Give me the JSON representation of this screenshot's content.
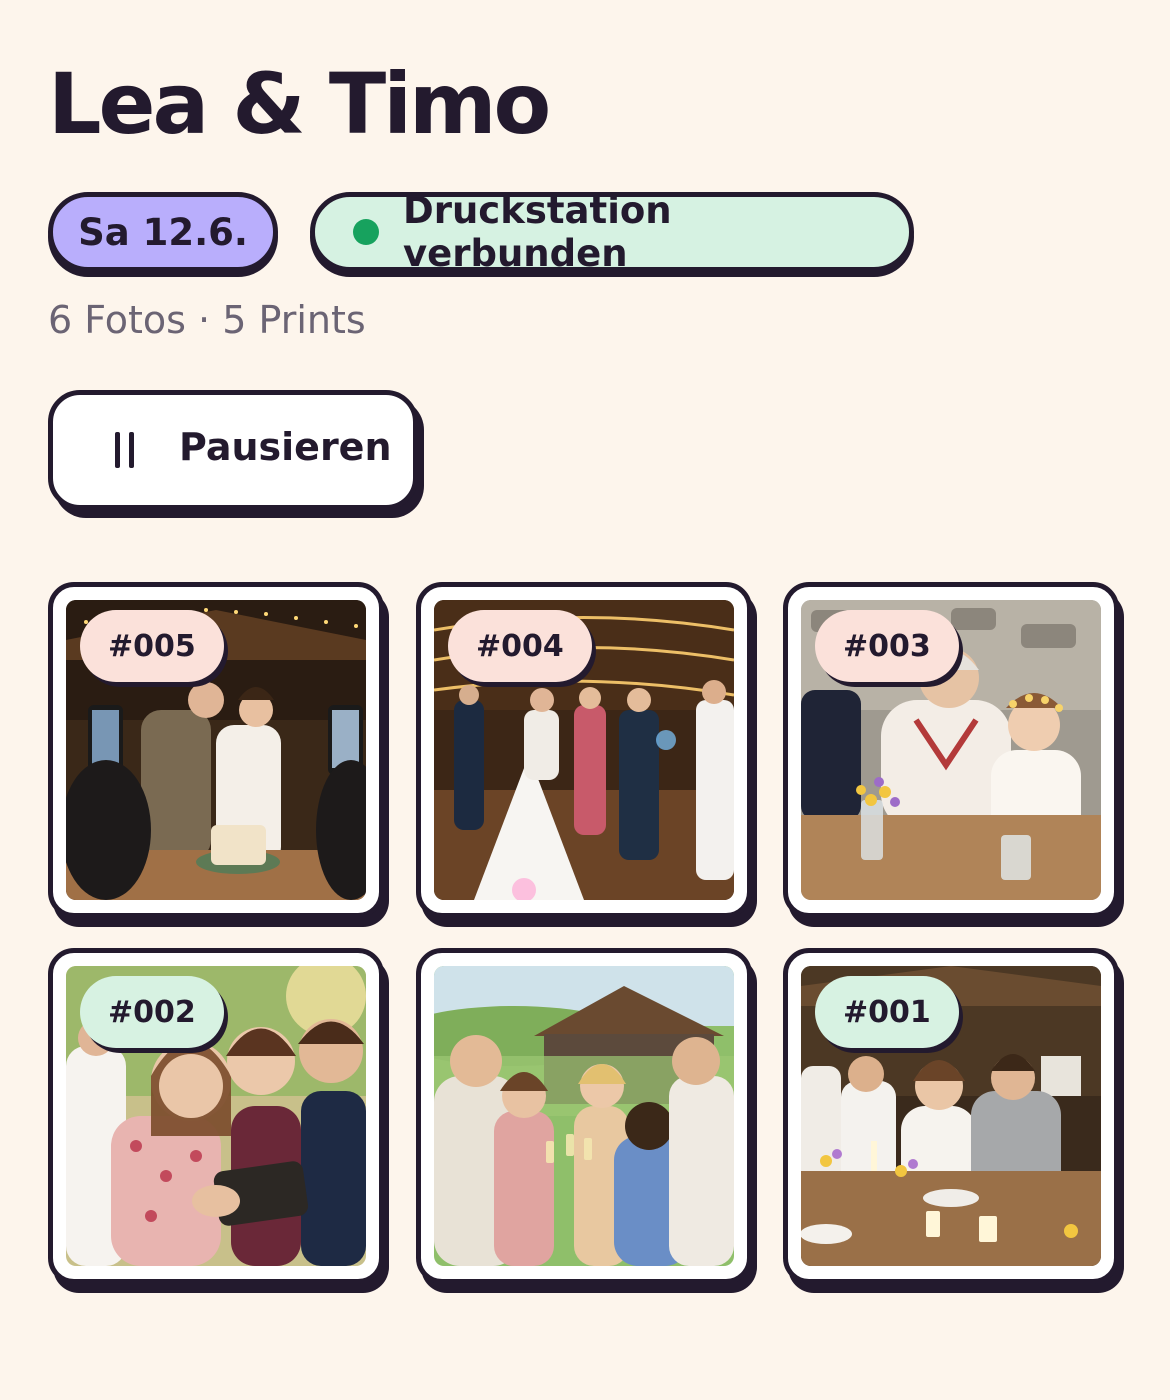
{
  "event": {
    "title": "Lea & Timo",
    "date_chip": "Sa 12.6.",
    "status_chip": "Druckstation verbunden",
    "counts": "6 Fotos · 5 Prints"
  },
  "actions": {
    "pause_label": "Pausieren"
  },
  "colors": {
    "background": "#fdf5ec",
    "ink": "#231a2e",
    "date_chip": "#b9aefc",
    "status_chip": "#d6f2e2",
    "status_dot": "#17a25e",
    "badge_pink": "#fbe1da",
    "badge_mint": "#d7f2e2"
  },
  "photos": [
    {
      "label": "#005",
      "badge_color": "pink",
      "scene": "cake-cutting"
    },
    {
      "label": "#004",
      "badge_color": "pink",
      "scene": "dance-floor"
    },
    {
      "label": "#003",
      "badge_color": "pink",
      "scene": "grandmother-and-girl"
    },
    {
      "label": "#002",
      "badge_color": "mint",
      "scene": "group-selfie"
    },
    {
      "label": "",
      "badge_color": "",
      "scene": "outdoor-toast"
    },
    {
      "label": "#001",
      "badge_color": "mint",
      "scene": "dinner-table"
    }
  ]
}
